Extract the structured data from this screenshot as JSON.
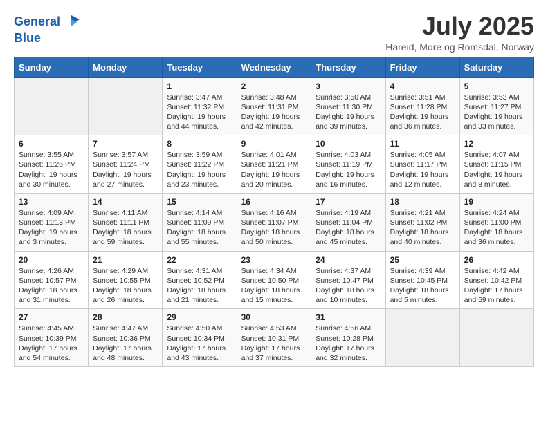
{
  "header": {
    "logo_line1": "General",
    "logo_line2": "Blue",
    "main_title": "July 2025",
    "subtitle": "Hareid, More og Romsdal, Norway"
  },
  "days_of_week": [
    "Sunday",
    "Monday",
    "Tuesday",
    "Wednesday",
    "Thursday",
    "Friday",
    "Saturday"
  ],
  "weeks": [
    [
      {
        "day": "",
        "info": ""
      },
      {
        "day": "",
        "info": ""
      },
      {
        "day": "1",
        "info": "Sunrise: 3:47 AM\nSunset: 11:32 PM\nDaylight: 19 hours\nand 44 minutes."
      },
      {
        "day": "2",
        "info": "Sunrise: 3:48 AM\nSunset: 11:31 PM\nDaylight: 19 hours\nand 42 minutes."
      },
      {
        "day": "3",
        "info": "Sunrise: 3:50 AM\nSunset: 11:30 PM\nDaylight: 19 hours\nand 39 minutes."
      },
      {
        "day": "4",
        "info": "Sunrise: 3:51 AM\nSunset: 11:28 PM\nDaylight: 19 hours\nand 36 minutes."
      },
      {
        "day": "5",
        "info": "Sunrise: 3:53 AM\nSunset: 11:27 PM\nDaylight: 19 hours\nand 33 minutes."
      }
    ],
    [
      {
        "day": "6",
        "info": "Sunrise: 3:55 AM\nSunset: 11:26 PM\nDaylight: 19 hours\nand 30 minutes."
      },
      {
        "day": "7",
        "info": "Sunrise: 3:57 AM\nSunset: 11:24 PM\nDaylight: 19 hours\nand 27 minutes."
      },
      {
        "day": "8",
        "info": "Sunrise: 3:59 AM\nSunset: 11:22 PM\nDaylight: 19 hours\nand 23 minutes."
      },
      {
        "day": "9",
        "info": "Sunrise: 4:01 AM\nSunset: 11:21 PM\nDaylight: 19 hours\nand 20 minutes."
      },
      {
        "day": "10",
        "info": "Sunrise: 4:03 AM\nSunset: 11:19 PM\nDaylight: 19 hours\nand 16 minutes."
      },
      {
        "day": "11",
        "info": "Sunrise: 4:05 AM\nSunset: 11:17 PM\nDaylight: 19 hours\nand 12 minutes."
      },
      {
        "day": "12",
        "info": "Sunrise: 4:07 AM\nSunset: 11:15 PM\nDaylight: 19 hours\nand 8 minutes."
      }
    ],
    [
      {
        "day": "13",
        "info": "Sunrise: 4:09 AM\nSunset: 11:13 PM\nDaylight: 19 hours\nand 3 minutes."
      },
      {
        "day": "14",
        "info": "Sunrise: 4:11 AM\nSunset: 11:11 PM\nDaylight: 18 hours\nand 59 minutes."
      },
      {
        "day": "15",
        "info": "Sunrise: 4:14 AM\nSunset: 11:09 PM\nDaylight: 18 hours\nand 55 minutes."
      },
      {
        "day": "16",
        "info": "Sunrise: 4:16 AM\nSunset: 11:07 PM\nDaylight: 18 hours\nand 50 minutes."
      },
      {
        "day": "17",
        "info": "Sunrise: 4:19 AM\nSunset: 11:04 PM\nDaylight: 18 hours\nand 45 minutes."
      },
      {
        "day": "18",
        "info": "Sunrise: 4:21 AM\nSunset: 11:02 PM\nDaylight: 18 hours\nand 40 minutes."
      },
      {
        "day": "19",
        "info": "Sunrise: 4:24 AM\nSunset: 11:00 PM\nDaylight: 18 hours\nand 36 minutes."
      }
    ],
    [
      {
        "day": "20",
        "info": "Sunrise: 4:26 AM\nSunset: 10:57 PM\nDaylight: 18 hours\nand 31 minutes."
      },
      {
        "day": "21",
        "info": "Sunrise: 4:29 AM\nSunset: 10:55 PM\nDaylight: 18 hours\nand 26 minutes."
      },
      {
        "day": "22",
        "info": "Sunrise: 4:31 AM\nSunset: 10:52 PM\nDaylight: 18 hours\nand 21 minutes."
      },
      {
        "day": "23",
        "info": "Sunrise: 4:34 AM\nSunset: 10:50 PM\nDaylight: 18 hours\nand 15 minutes."
      },
      {
        "day": "24",
        "info": "Sunrise: 4:37 AM\nSunset: 10:47 PM\nDaylight: 18 hours\nand 10 minutes."
      },
      {
        "day": "25",
        "info": "Sunrise: 4:39 AM\nSunset: 10:45 PM\nDaylight: 18 hours\nand 5 minutes."
      },
      {
        "day": "26",
        "info": "Sunrise: 4:42 AM\nSunset: 10:42 PM\nDaylight: 17 hours\nand 59 minutes."
      }
    ],
    [
      {
        "day": "27",
        "info": "Sunrise: 4:45 AM\nSunset: 10:39 PM\nDaylight: 17 hours\nand 54 minutes."
      },
      {
        "day": "28",
        "info": "Sunrise: 4:47 AM\nSunset: 10:36 PM\nDaylight: 17 hours\nand 48 minutes."
      },
      {
        "day": "29",
        "info": "Sunrise: 4:50 AM\nSunset: 10:34 PM\nDaylight: 17 hours\nand 43 minutes."
      },
      {
        "day": "30",
        "info": "Sunrise: 4:53 AM\nSunset: 10:31 PM\nDaylight: 17 hours\nand 37 minutes."
      },
      {
        "day": "31",
        "info": "Sunrise: 4:56 AM\nSunset: 10:28 PM\nDaylight: 17 hours\nand 32 minutes."
      },
      {
        "day": "",
        "info": ""
      },
      {
        "day": "",
        "info": ""
      }
    ]
  ]
}
